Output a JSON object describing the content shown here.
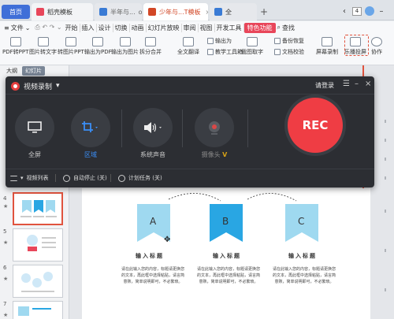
{
  "tabs": {
    "home": "首页",
    "t1": "稻壳模板",
    "t2": "半年与...",
    "t2_ext": "ocx",
    "t3": "少年与...T模板",
    "t4": "全",
    "count": "4"
  },
  "menu": {
    "file": "文件",
    "items": [
      "开始",
      "插入",
      "设计",
      "切换",
      "动画",
      "幻灯片放映",
      "审阅",
      "视图",
      "开发工具",
      "特色功能"
    ],
    "search": "查找"
  },
  "ribbon": {
    "pdf_to_ppt": "PDF转PPT",
    "img_to_text": "图片转文字",
    "to_img_ppt": "转图片PPT",
    "export_pdf": "输出为PDF",
    "export_img": "输出为图片",
    "split_merge": "拆分合并",
    "translate": "全文翻译",
    "export_as": "输出为",
    "teach_tools": "教学工具箱",
    "screenshot": "截图取字",
    "backup": "备份恢复",
    "doc_locate": "文档校验",
    "screen_record": "屏幕录制",
    "leboshare": "乐播投屏",
    "collab": "协作"
  },
  "outline": {
    "outline": "大纲",
    "slides": "幻灯片"
  },
  "thumbs": [
    {
      "num": "4",
      "star": "★"
    },
    {
      "num": "5",
      "star": "★"
    },
    {
      "num": "6",
      "star": "★"
    },
    {
      "num": "7",
      "star": "★"
    }
  ],
  "recorder": {
    "title": "视频录制",
    "login": "请登录",
    "fullscreen": "全屏",
    "region": "区域",
    "system_sound": "系统声音",
    "camera": "摄像头",
    "rec": "REC",
    "video_list": "视频列表",
    "auto_stop": "自动停止 (关)",
    "schedule": "计划任务 (关)"
  },
  "slide": {
    "flags": [
      "A",
      "B",
      "C"
    ],
    "col_title": "输入标题",
    "col_body": "请在此输入您的内容，标题请更换您的文本，再此框中选择粘贴，请言简意赅，简单说明即可，不必繁琐。"
  },
  "colors": {
    "accent_red": "#ef3d44",
    "accent_blue": "#3a8ef6",
    "flag_light": "#9fd9f0",
    "flag_dark": "#29a6e3",
    "menu_active": "#e8465a"
  }
}
